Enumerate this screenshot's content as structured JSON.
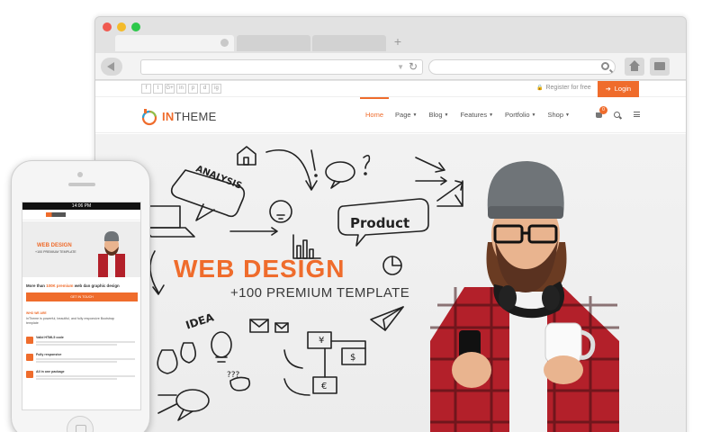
{
  "browser": {
    "new_tab_glyph": "+",
    "url_value": "",
    "search_value": ""
  },
  "site": {
    "topbar": {
      "socials": [
        "f",
        "t",
        "G+",
        "in",
        "p",
        "d",
        "ig"
      ],
      "register_label": "Register for free",
      "login_label": "Login"
    },
    "logo": {
      "prefix": "IN",
      "suffix": "THEME"
    },
    "nav": {
      "items": [
        {
          "label": "Home",
          "active": true,
          "caret": false
        },
        {
          "label": "Page",
          "active": false,
          "caret": true
        },
        {
          "label": "Blog",
          "active": false,
          "caret": true
        },
        {
          "label": "Features",
          "active": false,
          "caret": true
        },
        {
          "label": "Portfolio",
          "active": false,
          "caret": true
        },
        {
          "label": "Shop",
          "active": false,
          "caret": true
        }
      ],
      "cart_count": "0"
    },
    "hero": {
      "title": "WEB DESIGN",
      "subtitle": "+100 PREMIUM TEMPLATE",
      "doodles": {
        "analysis": "ANALYSIS",
        "product": "Product",
        "idea": "IDEA"
      }
    }
  },
  "phone": {
    "status_time": "14:06 PM",
    "hero_title": "WEB DESIGN",
    "hero_subtitle": "+100 PREMIUM TEMPLATE",
    "tagline_prefix": "More than ",
    "tagline_highlight": "100K premium",
    "tagline_suffix": " web dan graphic design",
    "cta_label": "GET IN TOUCH",
    "section_label": "WHO WE ARE",
    "description": "InTheme is powerful, beautiful, and fully responsive Bootstrap template",
    "features": [
      {
        "title": "Valid HTML5 code"
      },
      {
        "title": "Fully responsive"
      },
      {
        "title": "All in one package"
      }
    ]
  },
  "colors": {
    "accent": "#ef6c2c",
    "text_dark": "#3a3a3a",
    "browser_chrome": "#e2e2e2"
  }
}
